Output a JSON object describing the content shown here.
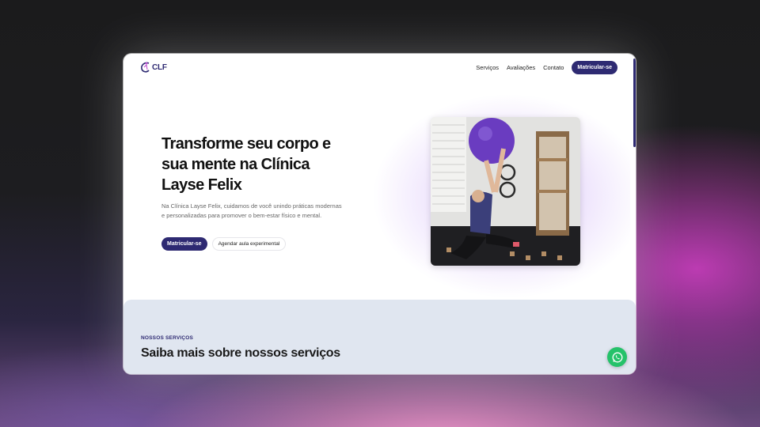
{
  "brand": {
    "logo_text": "CLF"
  },
  "nav": {
    "links": [
      "Serviços",
      "Avaliações",
      "Contato"
    ],
    "cta": "Matricular-se"
  },
  "hero": {
    "title": "Transforme seu corpo e sua mente na Clínica Layse Felix",
    "description": "Na Clínica Layse Felix, cuidamos de você unindo práticas modernas e personalizadas para promover o bem-estar físico e mental.",
    "primary_button": "Matricular-se",
    "secondary_button": "Agendar aula experimental"
  },
  "services": {
    "eyebrow": "NOSSOS SERVIÇOS",
    "title": "Saiba mais sobre nossos serviços"
  },
  "colors": {
    "brand_primary": "#2e2a72",
    "services_bg": "#e0e6f0",
    "whatsapp": "#25c26a"
  },
  "icons": {
    "logo": "clf-logo-icon",
    "whatsapp": "whatsapp-icon"
  }
}
